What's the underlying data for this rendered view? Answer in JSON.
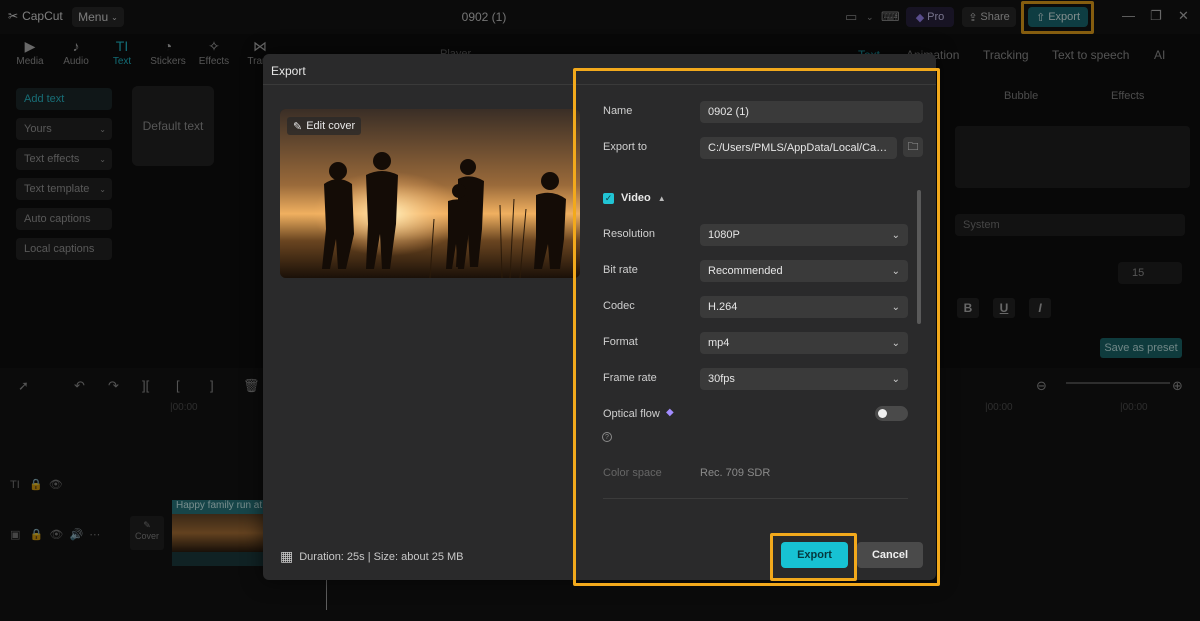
{
  "app": {
    "name": "CapCut",
    "menu_label": "Menu",
    "project_title": "0902 (1)"
  },
  "titlebar": {
    "pro_label": "Pro",
    "share_label": "Share",
    "export_label": "Export"
  },
  "toolbar": {
    "tools": [
      {
        "label": "Media",
        "icon": "media-icon"
      },
      {
        "label": "Audio",
        "icon": "audio-icon"
      },
      {
        "label": "Text",
        "icon": "text-icon"
      },
      {
        "label": "Stickers",
        "icon": "stickers-icon"
      },
      {
        "label": "Effects",
        "icon": "effects-icon"
      },
      {
        "label": "Trans",
        "icon": "transitions-icon"
      }
    ],
    "active": "Text"
  },
  "sidebar": {
    "items": [
      {
        "label": "Add text"
      },
      {
        "label": "Yours"
      },
      {
        "label": "Text effects"
      },
      {
        "label": "Text template"
      },
      {
        "label": "Auto captions"
      },
      {
        "label": "Local captions"
      }
    ],
    "default_text": "Default text"
  },
  "player": {
    "label": "Player"
  },
  "right_panel": {
    "tabs": [
      "Text",
      "Animation",
      "Tracking",
      "Text to speech",
      "AI"
    ],
    "sub_tabs": [
      "Bubble",
      "Effects"
    ],
    "font_value": "System",
    "font_size": "15",
    "format_buttons": [
      "B",
      "U",
      "I"
    ],
    "save_preset_label": "Save as preset"
  },
  "timeline": {
    "ruler": [
      "|00:00",
      "|00:00",
      "|00:00"
    ],
    "clip_label": "Happy family run at sunset",
    "cover_label": "Cover"
  },
  "dialog": {
    "title": "Export",
    "edit_cover_label": "Edit cover",
    "duration_text": "Duration: 25s | Size: about 25 MB",
    "name_label": "Name",
    "name_value": "0902 (1)",
    "export_to_label": "Export to",
    "export_to_value": "C:/Users/PMLS/AppData/Local/CapCut",
    "video_section_label": "Video",
    "settings": [
      {
        "label": "Resolution",
        "value": "1080P"
      },
      {
        "label": "Bit rate",
        "value": "Recommended"
      },
      {
        "label": "Codec",
        "value": "H.264"
      },
      {
        "label": "Format",
        "value": "mp4"
      },
      {
        "label": "Frame rate",
        "value": "30fps"
      }
    ],
    "optical_flow_label": "Optical flow",
    "optical_flow_on": false,
    "color_space_label": "Color space",
    "color_space_value": "Rec. 709 SDR",
    "export_button": "Export",
    "cancel_button": "Cancel"
  },
  "colors": {
    "accent": "#17c2d3",
    "highlight": "#f2a91c",
    "dialog_bg": "#2a2a2b"
  }
}
